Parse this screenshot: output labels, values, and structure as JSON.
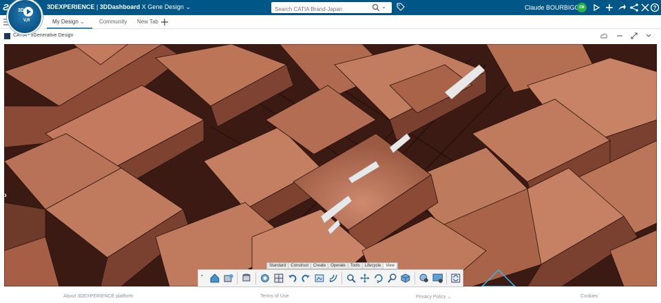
{
  "header": {
    "brand_platform": "3DEXPERIENCE",
    "brand_app": "3DDashboard",
    "brand_dashboard": "X Gene Design",
    "search_placeholder": "Search CATIA Brand-Japan",
    "user_name": "Claude BOURBIGOT",
    "user_initials": "CB",
    "compass_label_3d": "3D",
    "compass_label_vr": "V,R"
  },
  "tabs": [
    {
      "label": "My Design",
      "active": true
    },
    {
      "label": "Community",
      "active": false
    },
    {
      "label": "New Tab",
      "active": false
    }
  ],
  "widget": {
    "title": "CATIA - xGenerative Design"
  },
  "toolbar": {
    "tabs": [
      "Standard",
      "Construct",
      "Create",
      "Operate",
      "Tools",
      "Lifecycle",
      "View"
    ],
    "active_tab": "View",
    "icons": [
      "home-view-icon",
      "view-mode-icon",
      "layers-icon",
      "render-style-icon",
      "multi-view-icon",
      "undo-icon",
      "redo-icon",
      "capture-icon",
      "feed-icon",
      "zoom-icon",
      "pan-icon",
      "rotate-icon",
      "zoom-area-icon",
      "cube-view-icon",
      "search-view-icon",
      "screen-capture-icon",
      "sync-icon"
    ]
  },
  "footer": {
    "about": "About 3DEXPERIENCE platform",
    "terms": "Terms of Use",
    "privacy": "Privacy Policy",
    "cookies": "Cookies"
  },
  "colors": {
    "topbar": "#005686",
    "accent": "#2b7fb4",
    "avatar": "#2bb04b",
    "model_light": "#c47a5e",
    "model_mid": "#9c5a43",
    "model_dark": "#4a2318"
  }
}
